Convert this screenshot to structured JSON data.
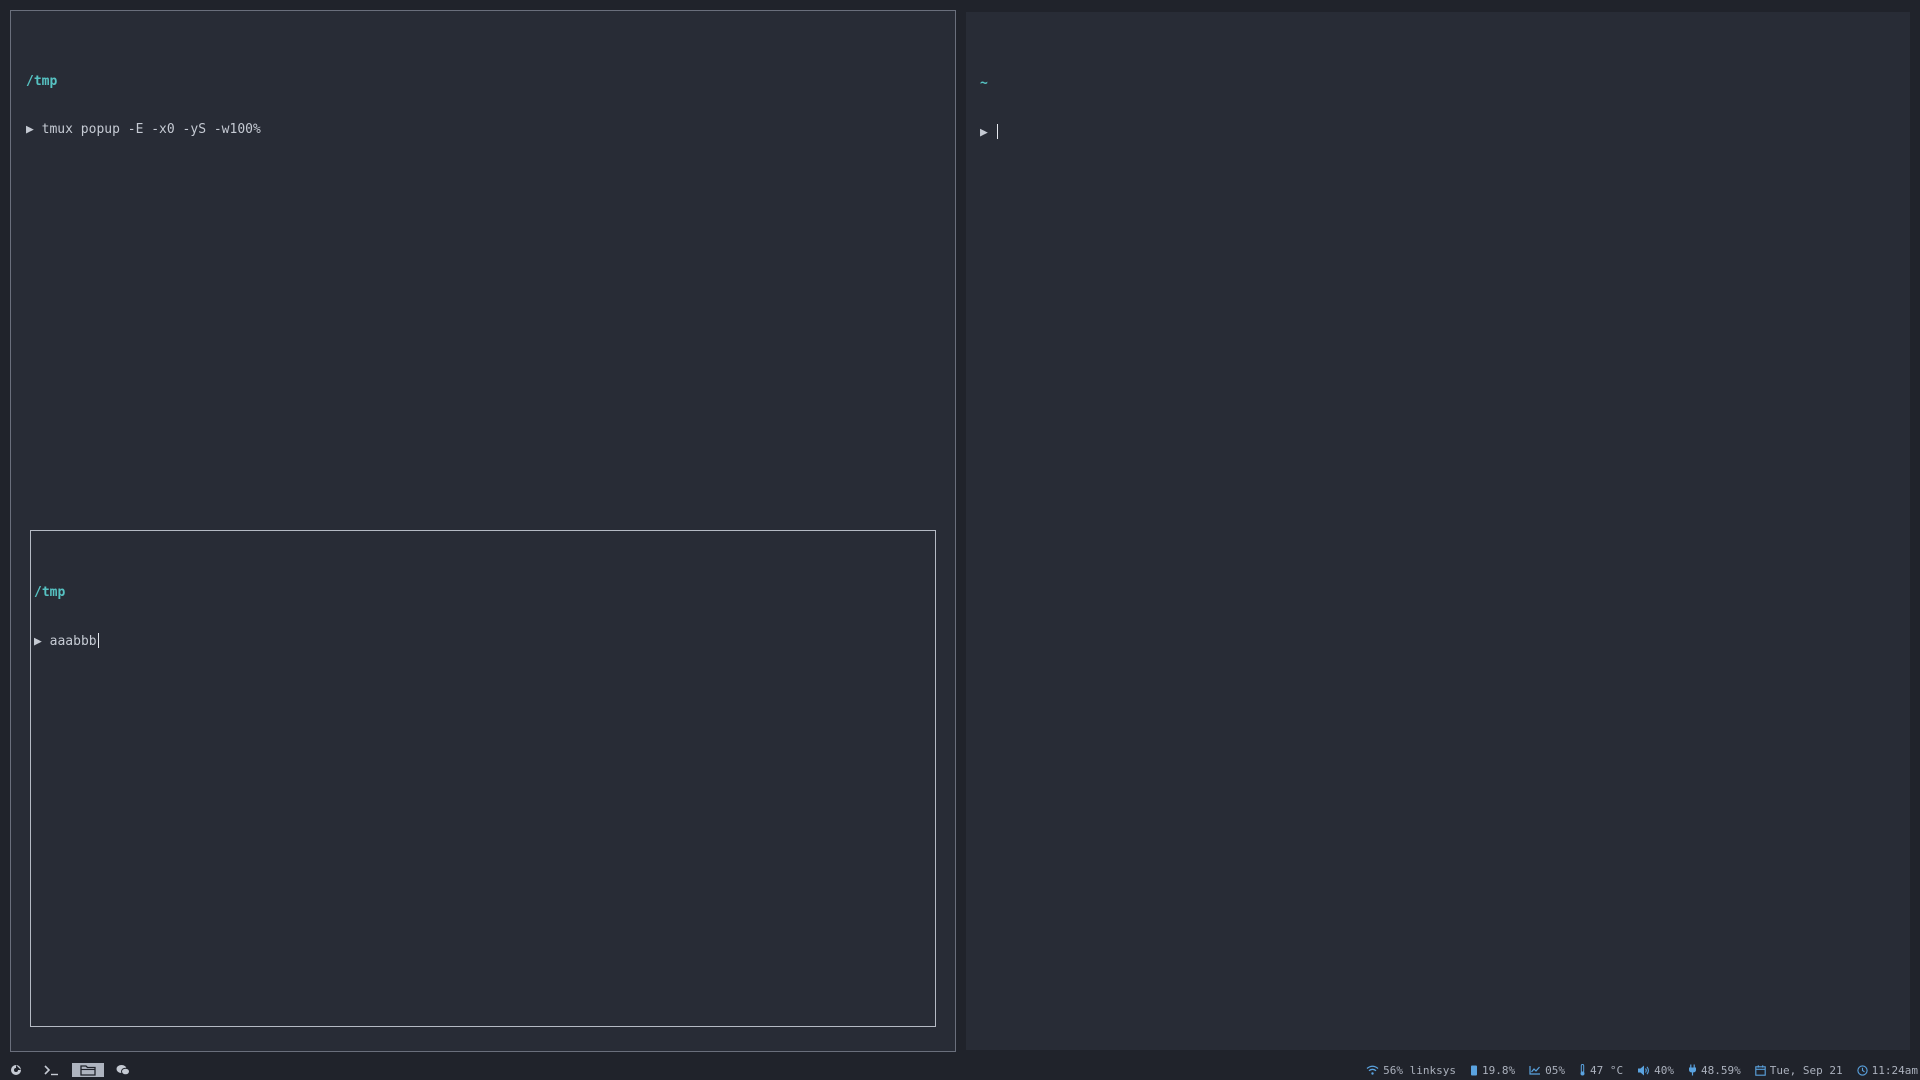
{
  "left_pane": {
    "cwd": "/tmp",
    "prompt": "▶",
    "command": "tmux popup -E -x0 -yS -w100%"
  },
  "popup": {
    "cwd": "/tmp",
    "prompt": "▶",
    "input": "aaabbb"
  },
  "right_pane": {
    "cwd": "~",
    "prompt": "▶",
    "input": ""
  },
  "taskbar": {
    "workspaces": [
      {
        "icon": "browser-icon",
        "active": false
      },
      {
        "icon": "terminal-icon",
        "active": false
      },
      {
        "icon": "folder-icon",
        "active": true
      },
      {
        "icon": "chat-icon",
        "active": false
      }
    ]
  },
  "status": {
    "wifi": "56% linksys",
    "memory": "19.8%",
    "cpu": "05%",
    "temperature": "47 °C",
    "volume": "40%",
    "battery": "48.59%",
    "date": "Tue, Sep 21",
    "time": "11:24am"
  },
  "colors": {
    "background": "#282c36",
    "cwd": "#56c3c3",
    "text": "#c5cad3",
    "status_icon": "#5aa3e0"
  }
}
